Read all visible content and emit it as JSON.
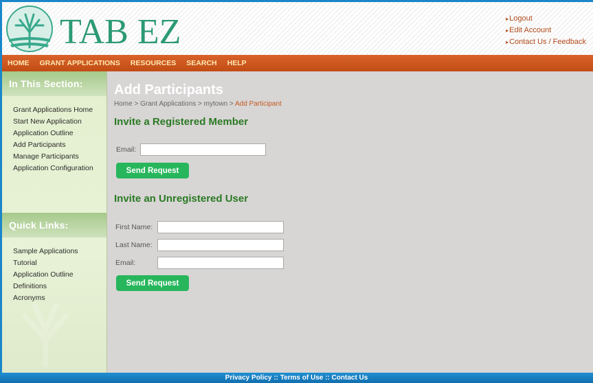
{
  "header": {
    "logo_text": "TAB EZ",
    "utility_links": [
      "Logout",
      "Edit Account",
      "Contact Us / Feedback"
    ]
  },
  "nav": {
    "items": [
      "HOME",
      "GRANT APPLICATIONS",
      "RESOURCES",
      "SEARCH",
      "HELP"
    ]
  },
  "sidebar": {
    "section_title": "In This Section:",
    "section_items": [
      "Grant Applications Home",
      "Start New Application",
      "Application Outline",
      "Add Participants",
      "Manage Participants",
      "Application Configuration"
    ],
    "quick_title": "Quick Links:",
    "quick_items": [
      "Sample Applications",
      "Tutorial",
      "Application Outline",
      "Definitions",
      "Acronyms"
    ]
  },
  "main": {
    "title": "Add Participants",
    "breadcrumb": [
      "Home",
      "Grant Applications",
      "mytown",
      "Add Participant"
    ],
    "breadcrumb_sep": " > ",
    "registered": {
      "heading": "Invite a Registered Member",
      "email_label": "Email:",
      "email_value": "",
      "button": "Send Request"
    },
    "unregistered": {
      "heading": "Invite an Unregistered User",
      "first_label": "First Name:",
      "last_label": "Last Name:",
      "email_label": "Email:",
      "first_value": "",
      "last_value": "",
      "email_value": "",
      "button": "Send Request"
    }
  },
  "footer": {
    "links": [
      "Privacy Policy",
      "Terms of Use",
      "Contact Us"
    ],
    "sep": " :: "
  },
  "colors": {
    "brand_green": "#2a7a23",
    "nav_orange": "#c14d15",
    "button_green": "#27b65c",
    "frame_blue": "#1a86c9"
  }
}
